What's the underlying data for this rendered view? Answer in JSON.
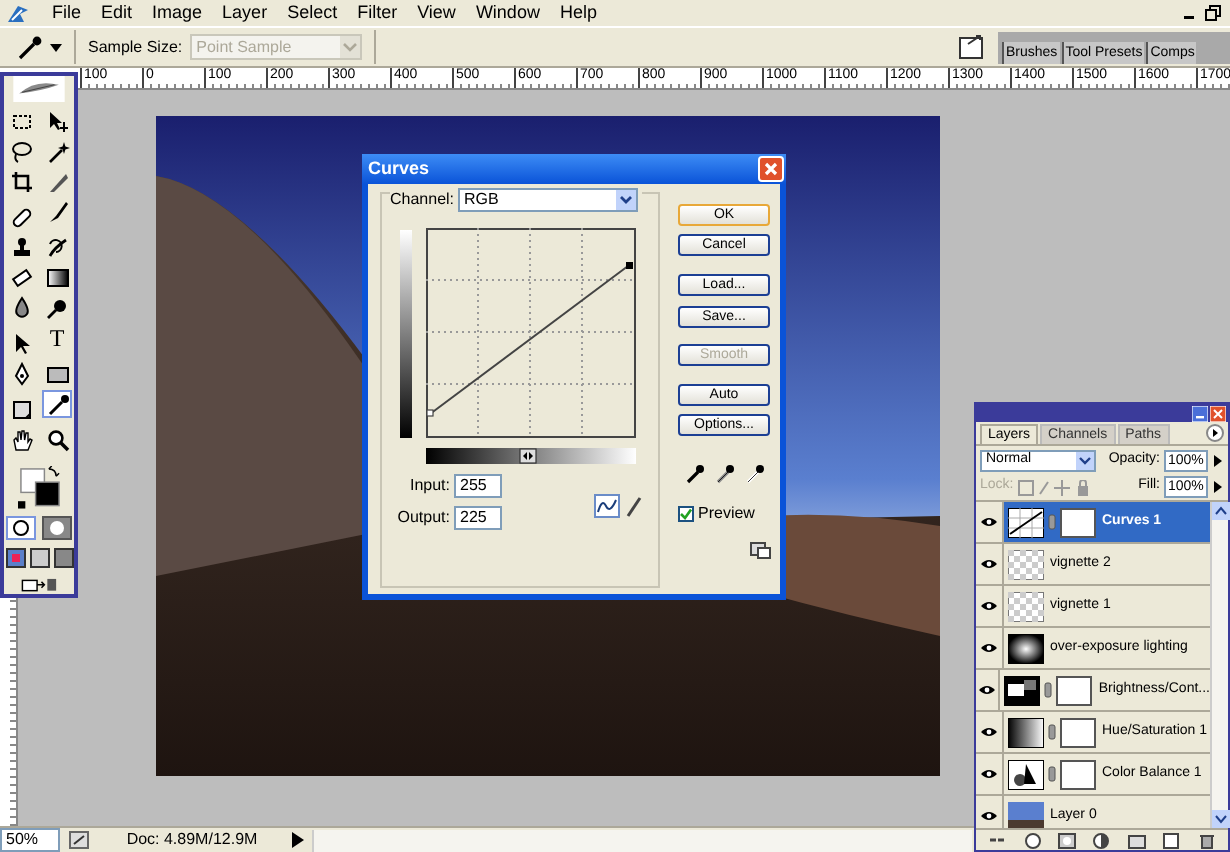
{
  "menu": [
    "File",
    "Edit",
    "Image",
    "Layer",
    "Select",
    "Filter",
    "View",
    "Window",
    "Help"
  ],
  "options_bar": {
    "sample_size_label": "Sample Size:",
    "sample_size_value": "Point Sample",
    "sample_size_disabled": true,
    "panel_tabs": [
      "Brushes",
      "Tool Presets",
      "Comps"
    ]
  },
  "ruler": {
    "labels": [
      "100",
      "0",
      "100",
      "200",
      "300",
      "400",
      "500",
      "600",
      "700",
      "800",
      "900",
      "1000",
      "1100",
      "1200",
      "1300",
      "1400",
      "1500",
      "1600",
      "1700"
    ]
  },
  "toolbox": {
    "tools": [
      {
        "kind": "marquee",
        "selected": false
      },
      {
        "kind": "move",
        "selected": false
      },
      {
        "kind": "lasso",
        "selected": false
      },
      {
        "kind": "wand",
        "selected": false
      },
      {
        "kind": "crop",
        "selected": false
      },
      {
        "kind": "slice",
        "selected": false
      },
      {
        "kind": "healing",
        "selected": false
      },
      {
        "kind": "brush",
        "selected": false
      },
      {
        "kind": "stamp",
        "selected": false
      },
      {
        "kind": "history",
        "selected": false
      },
      {
        "kind": "eraser",
        "selected": false
      },
      {
        "kind": "gradient",
        "selected": false
      },
      {
        "kind": "blur",
        "selected": false
      },
      {
        "kind": "dodge",
        "selected": false
      },
      {
        "kind": "select",
        "selected": false
      },
      {
        "kind": "type",
        "glyph": "T",
        "selected": false
      },
      {
        "kind": "pen",
        "selected": false
      },
      {
        "kind": "shape",
        "selected": false
      },
      {
        "kind": "notes",
        "selected": false
      },
      {
        "kind": "eyedropper",
        "selected": true
      },
      {
        "kind": "hand",
        "selected": false
      },
      {
        "kind": "zoom",
        "selected": false
      }
    ]
  },
  "curves": {
    "title": "Curves",
    "channel_label": "Channel:",
    "channel_value": "RGB",
    "buttons": [
      {
        "label": "OK",
        "default": true,
        "disabled": false
      },
      {
        "label": "Cancel",
        "default": false,
        "disabled": false
      },
      {
        "label": "Load...",
        "default": false,
        "disabled": false
      },
      {
        "label": "Save...",
        "default": false,
        "disabled": false
      },
      {
        "label": "Smooth",
        "default": false,
        "disabled": true
      },
      {
        "label": "Auto",
        "default": false,
        "disabled": false
      },
      {
        "label": "Options...",
        "default": false,
        "disabled": false
      }
    ],
    "input_label": "Input:",
    "input_value": "255",
    "output_label": "Output:",
    "output_value": "225",
    "preview": {
      "label": "Preview",
      "checked": true
    }
  },
  "layers_panel": {
    "tabs": [
      {
        "label": "Layers",
        "selected": true
      },
      {
        "label": "Channels",
        "selected": false
      },
      {
        "label": "Paths",
        "selected": false
      }
    ],
    "blend_mode": "Normal",
    "opacity_label": "Opacity:",
    "opacity_value": "100%",
    "lock_label": "Lock:",
    "fill_label": "Fill:",
    "fill_value": "100%",
    "layers": [
      {
        "name": "Curves 1",
        "kind": "curves",
        "mask": true,
        "selected": true,
        "visible": true
      },
      {
        "name": "vignette 2",
        "kind": "transparent",
        "mask": false,
        "selected": false,
        "visible": true
      },
      {
        "name": "vignette 1",
        "kind": "transparent",
        "mask": false,
        "selected": false,
        "visible": true
      },
      {
        "name": "over-exposure lighting",
        "kind": "radial",
        "mask": false,
        "selected": false,
        "visible": true
      },
      {
        "name": "Brightness/Cont...",
        "kind": "brightness",
        "mask": true,
        "selected": false,
        "visible": true
      },
      {
        "name": "Hue/Saturation 1",
        "kind": "hue",
        "mask": true,
        "selected": false,
        "visible": true
      },
      {
        "name": "Color Balance 1",
        "kind": "balance",
        "mask": true,
        "selected": false,
        "visible": true
      },
      {
        "name": "Layer 0",
        "kind": "photo",
        "mask": false,
        "selected": false,
        "visible": true
      }
    ]
  },
  "status_bar": {
    "zoom": "50%",
    "doc": "Doc: 4.89M/12.9M"
  }
}
